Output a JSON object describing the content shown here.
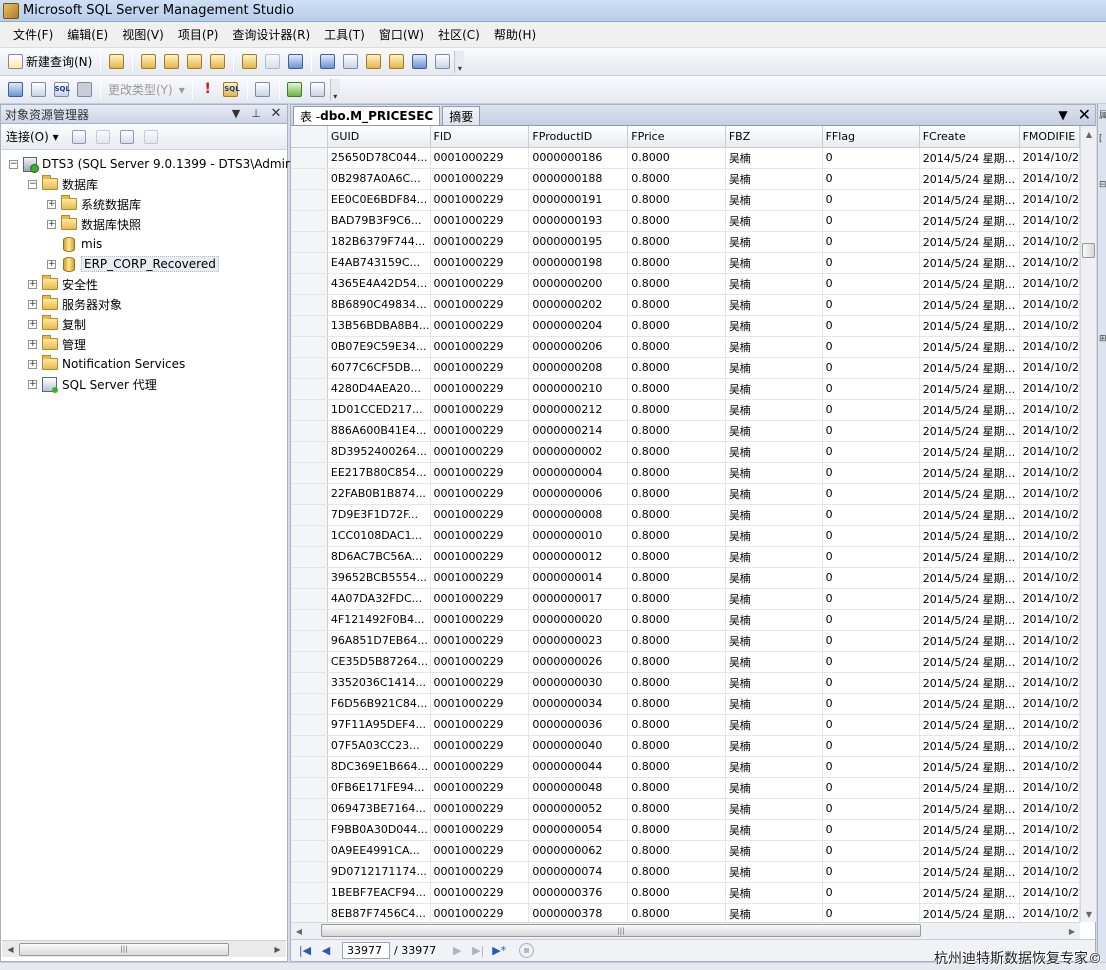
{
  "window": {
    "title": "Microsoft SQL Server Management Studio"
  },
  "menu": [
    "文件(F)",
    "编辑(E)",
    "视图(V)",
    "项目(P)",
    "查询设计器(R)",
    "工具(T)",
    "窗口(W)",
    "社区(C)",
    "帮助(H)"
  ],
  "toolbar1": {
    "new_query": "新建查询(N)"
  },
  "toolbar2": {
    "change_type": "更改类型(Y)"
  },
  "object_explorer": {
    "title": "对象资源管理器",
    "connect": "连接(O)",
    "server": "DTS3 (SQL Server 9.0.1399 - DTS3\\Admin",
    "databases": "数据库",
    "system_databases": "系统数据库",
    "db_snapshots": "数据库快照",
    "db_mis": "mis",
    "db_erp": "ERP_CORP_Recovered",
    "security": "安全性",
    "server_objects": "服务器对象",
    "replication": "复制",
    "management": "管理",
    "notification": "Notification Services",
    "agent": "SQL Server 代理"
  },
  "document": {
    "active_tab": {
      "prefix": "表 - ",
      "name": "dbo.M_PRICESEC"
    },
    "summary_tab": "摘要"
  },
  "grid": {
    "columns": [
      "GUID",
      "FID",
      "FProductID",
      "FPrice",
      "FBZ",
      "FFlag",
      "FCreate",
      "FMODIFIE"
    ],
    "rows": [
      [
        "25650D78C044...",
        "0001000229",
        "0000000186",
        "0.8000",
        "吴楠",
        "0",
        "2014/5/24 星期...",
        "2014/10/2"
      ],
      [
        "0B2987A0A6C...",
        "0001000229",
        "0000000188",
        "0.8000",
        "吴楠",
        "0",
        "2014/5/24 星期...",
        "2014/10/2"
      ],
      [
        "EE0C0E6BDF84...",
        "0001000229",
        "0000000191",
        "0.8000",
        "吴楠",
        "0",
        "2014/5/24 星期...",
        "2014/10/2"
      ],
      [
        "BAD79B3F9C6...",
        "0001000229",
        "0000000193",
        "0.8000",
        "吴楠",
        "0",
        "2014/5/24 星期...",
        "2014/10/2"
      ],
      [
        "182B6379F744...",
        "0001000229",
        "0000000195",
        "0.8000",
        "吴楠",
        "0",
        "2014/5/24 星期...",
        "2014/10/2"
      ],
      [
        "E4AB743159C...",
        "0001000229",
        "0000000198",
        "0.8000",
        "吴楠",
        "0",
        "2014/5/24 星期...",
        "2014/10/2"
      ],
      [
        "4365E4A42D54...",
        "0001000229",
        "0000000200",
        "0.8000",
        "吴楠",
        "0",
        "2014/5/24 星期...",
        "2014/10/2"
      ],
      [
        "8B6890C49834...",
        "0001000229",
        "0000000202",
        "0.8000",
        "吴楠",
        "0",
        "2014/5/24 星期...",
        "2014/10/2"
      ],
      [
        "13B56BDBA8B4...",
        "0001000229",
        "0000000204",
        "0.8000",
        "吴楠",
        "0",
        "2014/5/24 星期...",
        "2014/10/2"
      ],
      [
        "0B07E9C59E34...",
        "0001000229",
        "0000000206",
        "0.8000",
        "吴楠",
        "0",
        "2014/5/24 星期...",
        "2014/10/2"
      ],
      [
        "6077C6CF5DB...",
        "0001000229",
        "0000000208",
        "0.8000",
        "吴楠",
        "0",
        "2014/5/24 星期...",
        "2014/10/2"
      ],
      [
        "4280D4AEA20...",
        "0001000229",
        "0000000210",
        "0.8000",
        "吴楠",
        "0",
        "2014/5/24 星期...",
        "2014/10/2"
      ],
      [
        "1D01CCED217...",
        "0001000229",
        "0000000212",
        "0.8000",
        "吴楠",
        "0",
        "2014/5/24 星期...",
        "2014/10/2"
      ],
      [
        "886A600B41E4...",
        "0001000229",
        "0000000214",
        "0.8000",
        "吴楠",
        "0",
        "2014/5/24 星期...",
        "2014/10/2"
      ],
      [
        "8D3952400264...",
        "0001000229",
        "0000000002",
        "0.8000",
        "吴楠",
        "0",
        "2014/5/24 星期...",
        "2014/10/2"
      ],
      [
        "EE217B80C854...",
        "0001000229",
        "0000000004",
        "0.8000",
        "吴楠",
        "0",
        "2014/5/24 星期...",
        "2014/10/2"
      ],
      [
        "22FAB0B1B874...",
        "0001000229",
        "0000000006",
        "0.8000",
        "吴楠",
        "0",
        "2014/5/24 星期...",
        "2014/10/2"
      ],
      [
        "7D9E3F1D72F...",
        "0001000229",
        "0000000008",
        "0.8000",
        "吴楠",
        "0",
        "2014/5/24 星期...",
        "2014/10/2"
      ],
      [
        "1CC0108DAC1...",
        "0001000229",
        "0000000010",
        "0.8000",
        "吴楠",
        "0",
        "2014/5/24 星期...",
        "2014/10/2"
      ],
      [
        "8D6AC7BC56A...",
        "0001000229",
        "0000000012",
        "0.8000",
        "吴楠",
        "0",
        "2014/5/24 星期...",
        "2014/10/2"
      ],
      [
        "39652BCB5554...",
        "0001000229",
        "0000000014",
        "0.8000",
        "吴楠",
        "0",
        "2014/5/24 星期...",
        "2014/10/2"
      ],
      [
        "4A07DA32FDC...",
        "0001000229",
        "0000000017",
        "0.8000",
        "吴楠",
        "0",
        "2014/5/24 星期...",
        "2014/10/2"
      ],
      [
        "4F121492F0B4...",
        "0001000229",
        "0000000020",
        "0.8000",
        "吴楠",
        "0",
        "2014/5/24 星期...",
        "2014/10/2"
      ],
      [
        "96A851D7EB64...",
        "0001000229",
        "0000000023",
        "0.8000",
        "吴楠",
        "0",
        "2014/5/24 星期...",
        "2014/10/2"
      ],
      [
        "CE35D5B87264...",
        "0001000229",
        "0000000026",
        "0.8000",
        "吴楠",
        "0",
        "2014/5/24 星期...",
        "2014/10/2"
      ],
      [
        "3352036C1414...",
        "0001000229",
        "0000000030",
        "0.8000",
        "吴楠",
        "0",
        "2014/5/24 星期...",
        "2014/10/2"
      ],
      [
        "F6D56B921C84...",
        "0001000229",
        "0000000034",
        "0.8000",
        "吴楠",
        "0",
        "2014/5/24 星期...",
        "2014/10/2"
      ],
      [
        "97F11A95DEF4...",
        "0001000229",
        "0000000036",
        "0.8000",
        "吴楠",
        "0",
        "2014/5/24 星期...",
        "2014/10/2"
      ],
      [
        "07F5A03CC23...",
        "0001000229",
        "0000000040",
        "0.8000",
        "吴楠",
        "0",
        "2014/5/24 星期...",
        "2014/10/2"
      ],
      [
        "8DC369E1B664...",
        "0001000229",
        "0000000044",
        "0.8000",
        "吴楠",
        "0",
        "2014/5/24 星期...",
        "2014/10/2"
      ],
      [
        "0FB6E171FE94...",
        "0001000229",
        "0000000048",
        "0.8000",
        "吴楠",
        "0",
        "2014/5/24 星期...",
        "2014/10/2"
      ],
      [
        "069473BE7164...",
        "0001000229",
        "0000000052",
        "0.8000",
        "吴楠",
        "0",
        "2014/5/24 星期...",
        "2014/10/2"
      ],
      [
        "F9BB0A30D044...",
        "0001000229",
        "0000000054",
        "0.8000",
        "吴楠",
        "0",
        "2014/5/24 星期...",
        "2014/10/2"
      ],
      [
        "0A9EE4991CA...",
        "0001000229",
        "0000000062",
        "0.8000",
        "吴楠",
        "0",
        "2014/5/24 星期...",
        "2014/10/2"
      ],
      [
        "9D0712171174...",
        "0001000229",
        "0000000074",
        "0.8000",
        "吴楠",
        "0",
        "2014/5/24 星期...",
        "2014/10/2"
      ],
      [
        "1BEBF7EACF94...",
        "0001000229",
        "0000000376",
        "0.8000",
        "吴楠",
        "0",
        "2014/5/24 星期...",
        "2014/10/2"
      ],
      [
        "8EB87F7456C4...",
        "0001000229",
        "0000000378",
        "0.8000",
        "吴楠",
        "0",
        "2014/5/24 星期...",
        "2014/10/2"
      ]
    ]
  },
  "navigator": {
    "current_record": "33977",
    "total_records": "/ 33977"
  },
  "watermark": "杭州迪特斯数据恢复专家©"
}
